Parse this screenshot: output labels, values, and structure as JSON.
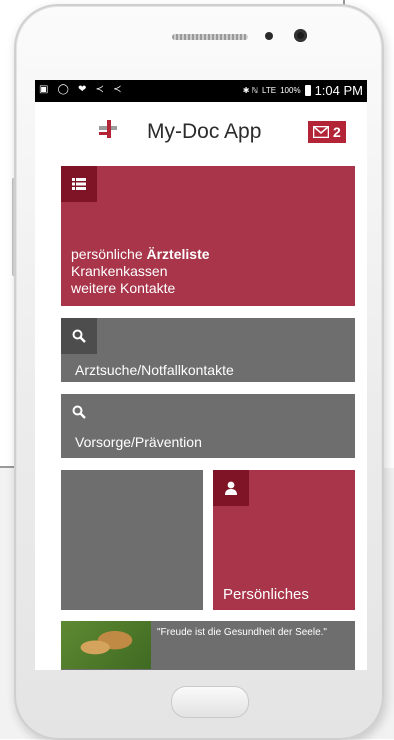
{
  "statusbar": {
    "left_icons": "▣ ◯ ❤ ≺ ≺",
    "right_icons": "✱ ℕ",
    "signal": "LTE",
    "battery_percent": "100%",
    "time": "1:04 PM"
  },
  "header": {
    "title": "My-Doc App",
    "mail_count": "2",
    "brand_color": "#b32437"
  },
  "tiles": {
    "contacts": {
      "icon": "list-icon",
      "line1_prefix": "persönliche ",
      "line1_bold": "Ärzteliste",
      "line2": "Krankenkassen",
      "line3": "weitere Kontakte"
    },
    "doctor_search": {
      "icon": "search-icon",
      "label": "Arztsuche/Notfallkontakte"
    },
    "prevention": {
      "icon": "search-icon",
      "label": "Vorsorge/Prävention"
    },
    "personal": {
      "icon": "person-icon",
      "label": "Persönliches"
    },
    "quote": {
      "text": "\"Freude ist die Gesundheit der Seele.\""
    }
  },
  "colors": {
    "red_tile": "#a8354a",
    "gray_tile": "#6e6e6e"
  }
}
